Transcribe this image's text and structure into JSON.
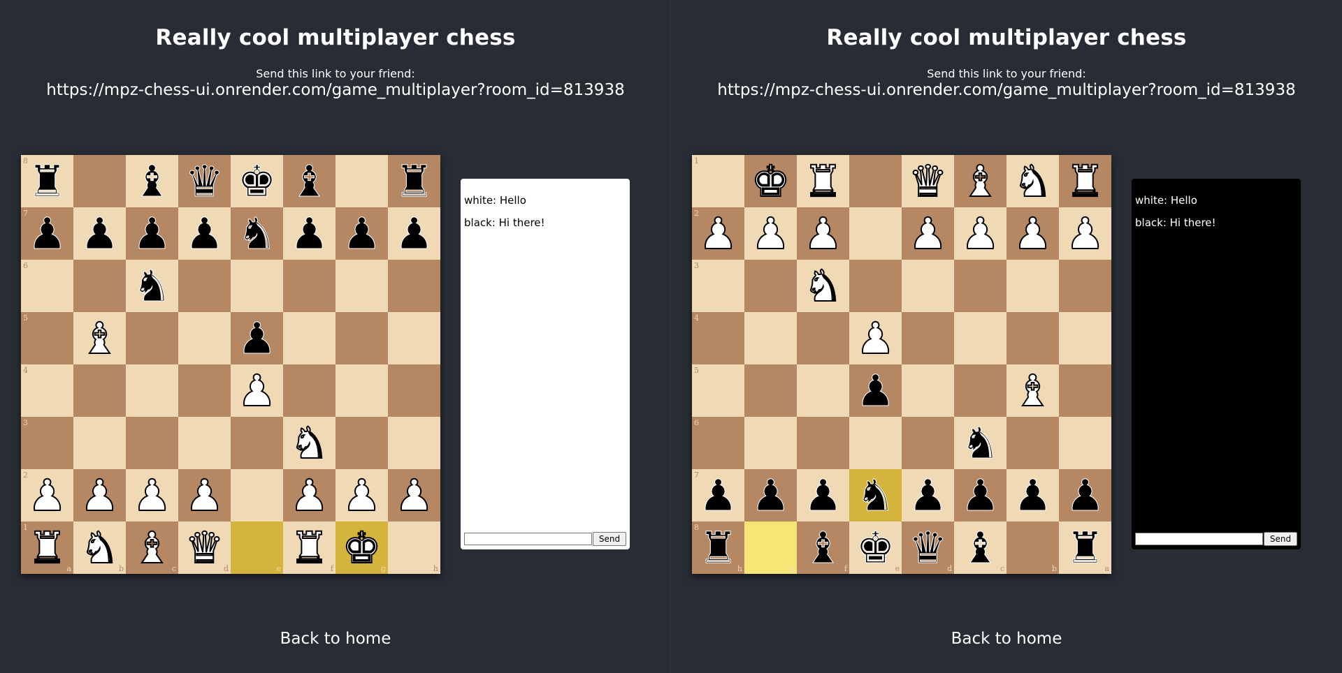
{
  "left": {
    "title": "Really cool multiplayer chess",
    "link_label": "Send this link to your friend:",
    "link_url": "https://mpz-chess-ui.onrender.com/game_multiplayer?room_id=813938",
    "orientation": "white",
    "ranks": [
      "8",
      "7",
      "6",
      "5",
      "4",
      "3",
      "2",
      "1"
    ],
    "files": [
      "a",
      "b",
      "c",
      "d",
      "e",
      "f",
      "g",
      "h"
    ],
    "position": [
      [
        "bR",
        "",
        "bB",
        "bQ",
        "bK",
        "bB",
        "",
        "bR"
      ],
      [
        "bP",
        "bP",
        "bP",
        "bP",
        "bN",
        "bP",
        "bP",
        "bP"
      ],
      [
        "",
        "",
        "bN",
        "",
        "",
        "",
        "",
        ""
      ],
      [
        "",
        "wB",
        "",
        "",
        "bP",
        "",
        "",
        ""
      ],
      [
        "",
        "",
        "",
        "",
        "wP",
        "",
        "",
        ""
      ],
      [
        "",
        "",
        "",
        "",
        "",
        "wN",
        "",
        ""
      ],
      [
        "wP",
        "wP",
        "wP",
        "wP",
        "",
        "wP",
        "wP",
        "wP"
      ],
      [
        "wR",
        "wN",
        "wB",
        "wQ",
        "",
        "wR",
        "wK",
        ""
      ]
    ],
    "highlighted": [
      [
        7,
        4
      ],
      [
        7,
        6
      ]
    ],
    "chat": {
      "theme": "light",
      "messages": [
        "white: Hello",
        "black: Hi there!"
      ],
      "input_value": "",
      "send_label": "Send"
    },
    "back_label": "Back to home"
  },
  "right": {
    "title": "Really cool multiplayer chess",
    "link_label": "Send this link to your friend:",
    "link_url": "https://mpz-chess-ui.onrender.com/game_multiplayer?room_id=813938",
    "orientation": "black",
    "ranks": [
      "1",
      "2",
      "3",
      "4",
      "5",
      "6",
      "7",
      "8"
    ],
    "files": [
      "h",
      "g",
      "f",
      "e",
      "d",
      "c",
      "b",
      "a"
    ],
    "position": [
      [
        "",
        "wK",
        "wR",
        "",
        "wQ",
        "wB",
        "wN",
        "wR"
      ],
      [
        "wP",
        "wP",
        "wP",
        "",
        "wP",
        "wP",
        "wP",
        "wP"
      ],
      [
        "",
        "",
        "wN",
        "",
        "",
        "",
        "",
        ""
      ],
      [
        "",
        "",
        "",
        "wP",
        "",
        "",
        "",
        ""
      ],
      [
        "",
        "",
        "",
        "bP",
        "",
        "",
        "wB",
        ""
      ],
      [
        "",
        "",
        "",
        "",
        "",
        "bN",
        "",
        ""
      ],
      [
        "bP",
        "bP",
        "bP",
        "bN",
        "bP",
        "bP",
        "bP",
        "bP"
      ],
      [
        "bR",
        "",
        "bB",
        "bK",
        "bQ",
        "bB",
        "",
        "bR"
      ]
    ],
    "highlighted": [
      [
        6,
        3
      ],
      [
        7,
        1
      ]
    ],
    "chat": {
      "theme": "dark",
      "messages": [
        "white: Hello",
        "black: Hi there!"
      ],
      "input_value": "",
      "send_label": "Send"
    },
    "back_label": "Back to home"
  },
  "piece_glyphs": {
    "K": "♚",
    "Q": "♛",
    "R": "♜",
    "B": "♝",
    "N": "♞",
    "P": "♟"
  },
  "piece_names": {
    "K": "king",
    "Q": "queen",
    "R": "rook",
    "B": "bishop",
    "N": "knight",
    "P": "pawn"
  },
  "colors": {
    "background": "#282c34",
    "light_square": "#f0d9b5",
    "dark_square": "#b58863",
    "highlight": "#d4b43c"
  }
}
